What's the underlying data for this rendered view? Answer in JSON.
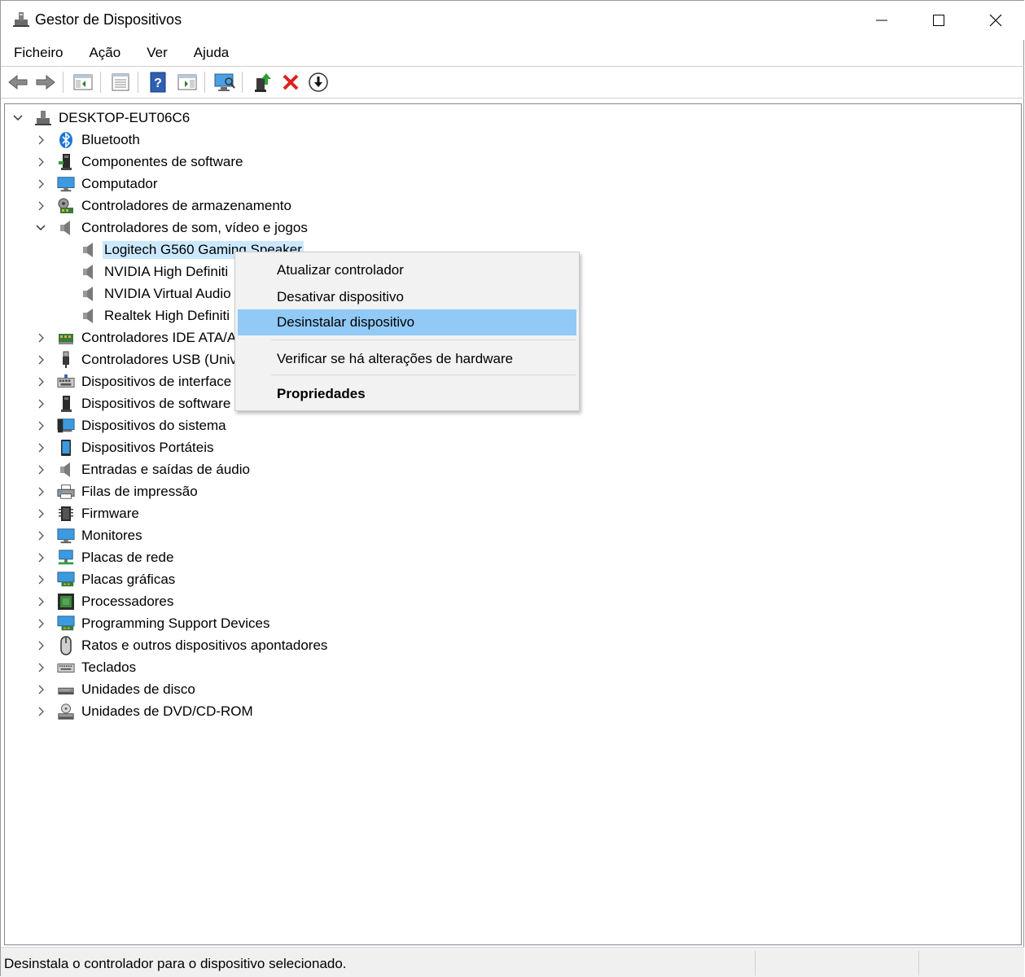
{
  "window": {
    "title": "Gestor de Dispositivos"
  },
  "menubar": {
    "items": [
      "Ficheiro",
      "Ação",
      "Ver",
      "Ajuda"
    ]
  },
  "toolbar": {
    "buttons": [
      "back-icon",
      "forward-icon",
      "show-hide-console-tree-icon",
      "properties-icon",
      "help-icon",
      "action-pane-icon",
      "scan-hardware-icon",
      "update-driver-icon",
      "uninstall-device-icon",
      "disable-device-icon"
    ]
  },
  "tree": {
    "root": "DESKTOP-EUT06C6",
    "categories": [
      "Bluetooth",
      "Componentes de software",
      "Computador",
      "Controladores de armazenamento",
      "Controladores de som, vídeo e jogos",
      "Controladores IDE ATA/A",
      "Controladores USB (Univ",
      "Dispositivos de interface",
      "Dispositivos de software",
      "Dispositivos do sistema",
      "Dispositivos Portáteis",
      "Entradas e saídas de áudio",
      "Filas de impressão",
      "Firmware",
      "Monitores",
      "Placas de rede",
      "Placas gráficas",
      "Processadores",
      "Programming Support Devices",
      "Ratos e outros dispositivos apontadores",
      "Teclados",
      "Unidades de disco",
      "Unidades de DVD/CD-ROM"
    ],
    "sound_children": [
      "Logitech G560 Gaming Speaker",
      "NVIDIA High Definiti",
      "NVIDIA Virtual Audio",
      "Realtek High Definiti"
    ]
  },
  "context_menu": {
    "update": "Atualizar controlador",
    "disable": "Desativar dispositivo",
    "uninstall": "Desinstalar dispositivo",
    "scan": "Verificar se há alterações de hardware",
    "properties": "Propriedades"
  },
  "statusbar": {
    "text": "Desinstala o controlador para o dispositivo selecionado."
  }
}
